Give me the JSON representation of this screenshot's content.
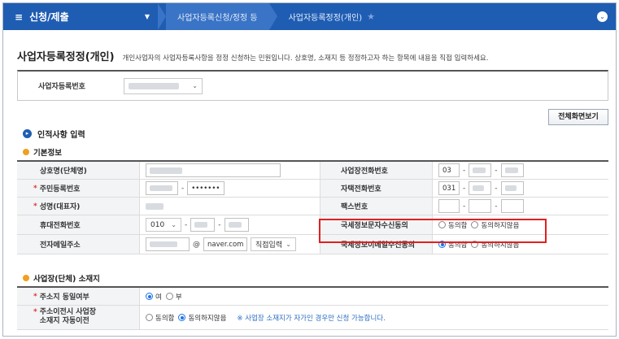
{
  "nav": {
    "menu_label": "신청/제출",
    "crumbs": [
      "사업자등록신청/정정 등",
      "사업자등록정정(개인)"
    ]
  },
  "page": {
    "title": "사업자등록정정(개인)",
    "description": "개인사업자의 사업자등록사항을 정정 신청하는 민원입니다. 상호명, 소재지 등 정정하고자 하는 항목에 내용을 직접 입력하세요."
  },
  "bizno": {
    "label": "사업자등록번호"
  },
  "buttons": {
    "full_view": "전체화면보기"
  },
  "section": {
    "title": "인적사항 입력"
  },
  "basic": {
    "title": "기본정보",
    "fields": {
      "company_name": "상호명(단체명)",
      "biz_phone": "사업장전화번호",
      "resident_no": "주민등록번호",
      "resident_mask": "•••••••",
      "home_phone": "자택전화번호",
      "name": "성명(대표자)",
      "fax": "팩스번호",
      "mobile": "휴대전화번호",
      "sms_consent": "국세정보문자수신동의",
      "email": "전자메일주소",
      "email_consent": "국세정보이메일수신동의"
    },
    "values": {
      "biz_phone_area": "03",
      "home_phone_area": "031",
      "mobile_prefix": "010",
      "email_at": "@",
      "email_domain": "naver.com",
      "email_direct": "직접입력"
    },
    "consent": {
      "agree": "동의함",
      "disagree": "동의하지않음"
    }
  },
  "location": {
    "title": "사업장(단체) 소재지",
    "same_label": "주소지 동일여부",
    "yes": "여",
    "no": "부",
    "auto_label_1": "주소이전시 사업장",
    "auto_label_2": "소재지 자동이전",
    "agree": "동의함",
    "disagree": "동의하지않음",
    "note": "※ 사업장 소재지가 자가인 경우만 신청 가능합니다."
  }
}
